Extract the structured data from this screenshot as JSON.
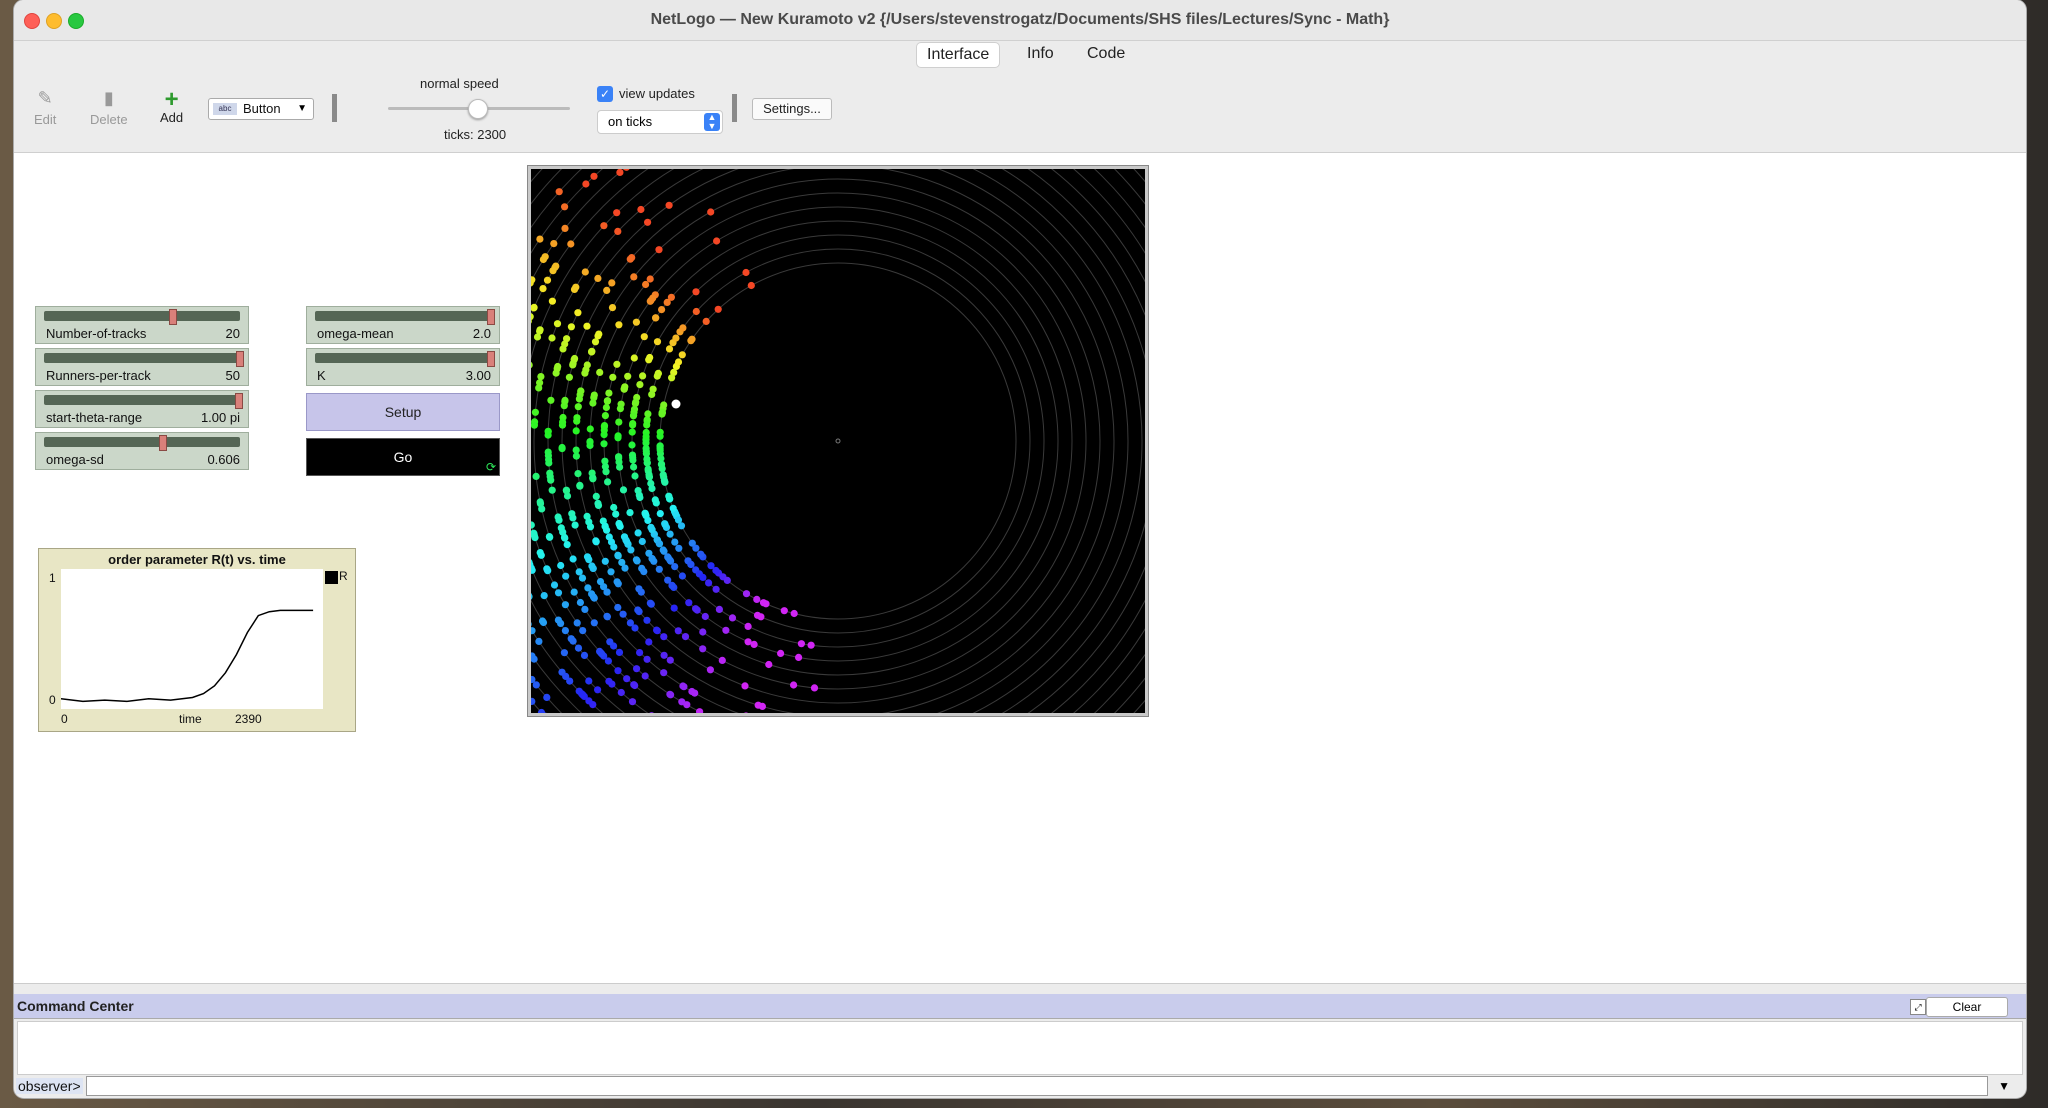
{
  "window": {
    "title": "NetLogo — New Kuramoto v2 {/Users/stevenstrogatz/Documents/SHS files/Lectures/Sync - Math}"
  },
  "tabs": [
    {
      "label": "Interface",
      "active": true
    },
    {
      "label": "Info"
    },
    {
      "label": "Code"
    }
  ],
  "toolbar": {
    "edit_label": "Edit",
    "delete_label": "Delete",
    "add_label": "Add",
    "widget_type": "Button",
    "speed_label": "normal speed",
    "ticks_label": "ticks: 2300",
    "view_updates_label": "view updates",
    "view_updates_checked": true,
    "update_mode": "on ticks",
    "settings_label": "Settings..."
  },
  "sliders": [
    {
      "name": "Number-of-tracks",
      "value": "20",
      "fraction": 0.6
    },
    {
      "name": "Runners-per-track",
      "value": "50",
      "fraction": 1.0
    },
    {
      "name": "start-theta-range",
      "value": "1.00 pi",
      "fraction": 1.0
    },
    {
      "name": "omega-sd",
      "value": "0.606",
      "fraction": 0.6
    },
    {
      "name": "omega-mean",
      "value": "2.0",
      "fraction": 1.0
    },
    {
      "name": "K",
      "value": "3.00",
      "fraction": 1.0
    }
  ],
  "buttons": {
    "setup_label": "Setup",
    "go_label": "Go"
  },
  "plot": {
    "title": "order parameter R(t) vs. time",
    "xlabel": "time",
    "xmin_label": "0",
    "xmax_label": "2390",
    "ymin_label": "0",
    "ymax_label": "1",
    "legend_label": "R"
  },
  "chart_data": {
    "type": "line",
    "title": "order parameter R(t) vs. time",
    "xlabel": "time",
    "ylabel": "",
    "xlim": [
      0,
      2390
    ],
    "ylim": [
      0,
      1
    ],
    "series": [
      {
        "name": "R",
        "x": [
          0,
          200,
          400,
          600,
          800,
          1000,
          1200,
          1300,
          1400,
          1500,
          1600,
          1700,
          1800,
          1900,
          2000,
          2100,
          2200,
          2300
        ],
        "values": [
          0.04,
          0.02,
          0.03,
          0.02,
          0.04,
          0.03,
          0.05,
          0.08,
          0.14,
          0.24,
          0.38,
          0.55,
          0.68,
          0.71,
          0.72,
          0.72,
          0.72,
          0.72
        ]
      }
    ]
  },
  "command_center": {
    "title": "Command Center",
    "clear_label": "Clear",
    "prompt_label": "observer>"
  },
  "colors": {
    "slider_bg": "#cbd7c9",
    "button_bg": "#c7c5ea",
    "plot_bg": "#e8e6c5",
    "command_bar": "#c9ccec"
  }
}
